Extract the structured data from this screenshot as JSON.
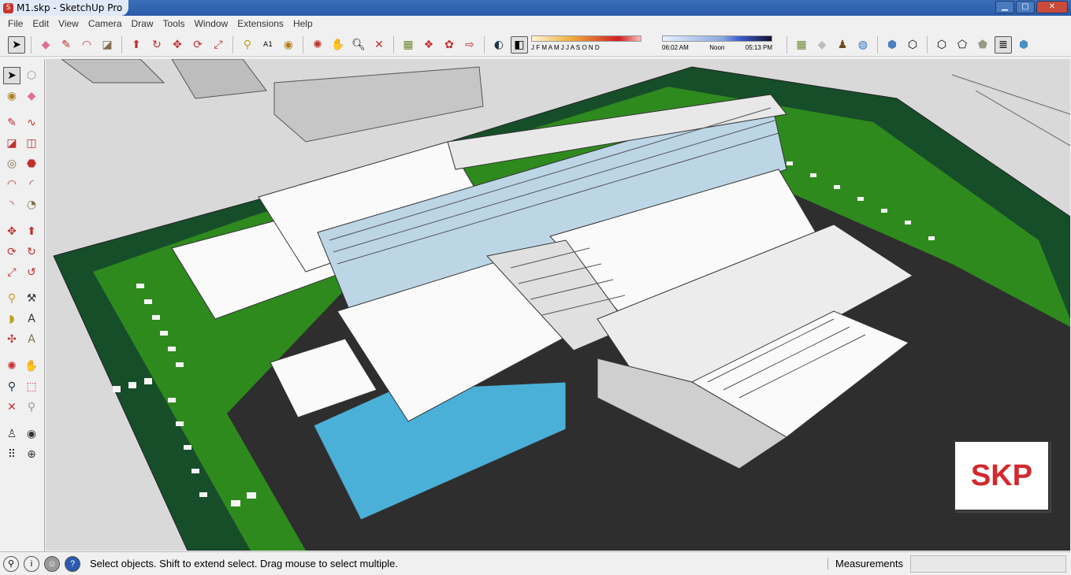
{
  "window": {
    "title": "M1.skp - SketchUp Pro",
    "app_icon": "sketchup-icon",
    "controls": [
      "minimize",
      "maximize",
      "close"
    ]
  },
  "menu": [
    "File",
    "Edit",
    "View",
    "Camera",
    "Draw",
    "Tools",
    "Window",
    "Extensions",
    "Help"
  ],
  "shadow_settings": {
    "months": "J F M A M J J A S O N D",
    "time_start": "06:02 AM",
    "time_mid": "Noon",
    "time_end": "05:13 PM"
  },
  "status": {
    "hint": "Select objects. Shift to extend select. Drag mouse to select multiple.",
    "measurements_label": "Measurements",
    "measurements_value": ""
  },
  "watermark": "SKP",
  "colors": {
    "grass": "#2f8a1e",
    "hedge": "#164e2a",
    "asphalt": "#2e2e2e",
    "water": "#4bb0d8",
    "ground": "#d8d8d8"
  }
}
